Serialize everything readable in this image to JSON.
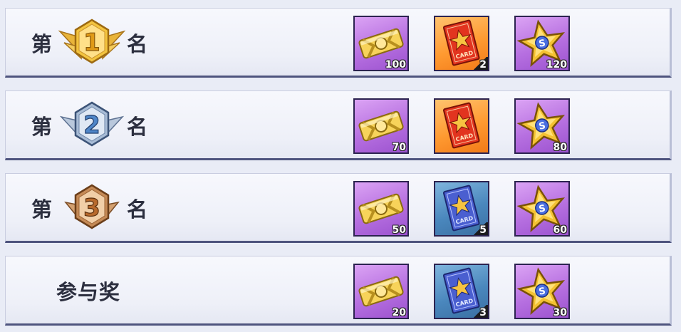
{
  "ranks": [
    {
      "prefix": "第",
      "suffix": "名",
      "badge": {
        "number": "1",
        "metal": "gold"
      },
      "rewards": [
        {
          "icon": "gold-ticket-icon",
          "bg": "purple",
          "qty": "100"
        },
        {
          "icon": "red-card-icon",
          "bg": "orange",
          "qty": "2"
        },
        {
          "icon": "gold-star-icon",
          "bg": "purple",
          "qty": "120"
        }
      ]
    },
    {
      "prefix": "第",
      "suffix": "名",
      "badge": {
        "number": "2",
        "metal": "silver"
      },
      "rewards": [
        {
          "icon": "gold-ticket-icon",
          "bg": "purple",
          "qty": "70"
        },
        {
          "icon": "red-card-icon",
          "bg": "orange",
          "qty": ""
        },
        {
          "icon": "gold-star-icon",
          "bg": "purple",
          "qty": "80"
        }
      ]
    },
    {
      "prefix": "第",
      "suffix": "名",
      "badge": {
        "number": "3",
        "metal": "bronze"
      },
      "rewards": [
        {
          "icon": "gold-ticket-icon",
          "bg": "purple",
          "qty": "50"
        },
        {
          "icon": "blue-card-icon",
          "bg": "blue",
          "qty": "5"
        },
        {
          "icon": "gold-star-icon",
          "bg": "purple",
          "qty": "60"
        }
      ]
    }
  ],
  "participation": {
    "label": "参与奖",
    "rewards": [
      {
        "icon": "gold-ticket-icon",
        "bg": "purple",
        "qty": "20"
      },
      {
        "icon": "blue-card-icon",
        "bg": "blue",
        "qty": "3"
      },
      {
        "icon": "gold-star-icon",
        "bg": "purple",
        "qty": "30"
      }
    ]
  },
  "card_text": "CARD",
  "star_letter": "S",
  "colors": {
    "gold": "#f2c23b",
    "silver": "#9fb3cc",
    "bronze": "#c58a56",
    "purple_bg": "#b66fe0",
    "orange_bg": "#ff9a31",
    "blue_bg": "#4a87bd"
  }
}
